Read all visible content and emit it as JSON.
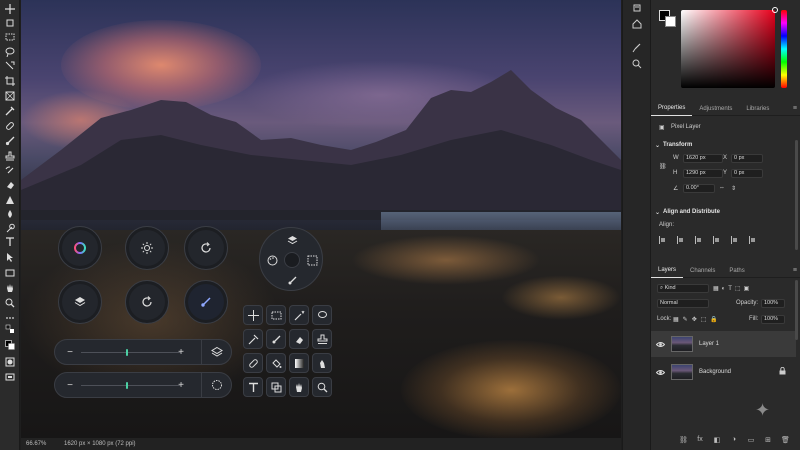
{
  "toolbar": {
    "tools": [
      "move-tool",
      "artboard-tool",
      "marquee-tool",
      "lasso-tool",
      "object-select-tool",
      "crop-tool",
      "frame-tool",
      "eyedropper-tool",
      "spot-heal-tool",
      "brush-tool",
      "clone-stamp-tool",
      "history-brush-tool",
      "eraser-tool",
      "gradient-tool",
      "blur-tool",
      "dodge-tool",
      "pen-tool",
      "type-tool",
      "path-select-tool",
      "shape-tool",
      "hand-tool",
      "zoom-tool",
      "more-tools"
    ]
  },
  "status": {
    "zoom": "66.67%",
    "doc_info": "1620 px × 1080 px (72 ppi)"
  },
  "color": {
    "foreground": "#000000",
    "background": "#ffffff",
    "picker_hue": "#e8001c",
    "accent": "#4cd0a4"
  },
  "properties": {
    "tabs": [
      "Properties",
      "Adjustments",
      "Libraries"
    ],
    "layer_type": "Pixel Layer",
    "transform_heading": "Transform",
    "w_label": "W",
    "w_value": "1620 px",
    "h_label": "H",
    "h_value": "1290 px",
    "x_label": "X",
    "x_value": "0 px",
    "y_label": "Y",
    "y_value": "0 px",
    "angle_value": "0.00°",
    "align_heading": "Align and Distribute",
    "align_label": "Align:"
  },
  "layers": {
    "tabs": [
      "Layers",
      "Channels",
      "Paths"
    ],
    "filter": "Kind",
    "blend_mode": "Normal",
    "opacity_label": "Opacity:",
    "opacity_value": "100%",
    "lock_label": "Lock:",
    "fill_label": "Fill:",
    "fill_value": "100%",
    "items": [
      {
        "name": "Layer 1",
        "selected": true,
        "locked": false
      },
      {
        "name": "Background",
        "selected": false,
        "locked": true
      }
    ],
    "footer_link": "fx"
  },
  "floating_controls": {
    "dials": [
      "color-wheel-icon",
      "brightness-icon",
      "rotate-icon",
      "layers-icon",
      "rotate-icon",
      "brush-icon"
    ],
    "slider_top_value": 0.45,
    "slider_bottom_value": 0.45
  }
}
